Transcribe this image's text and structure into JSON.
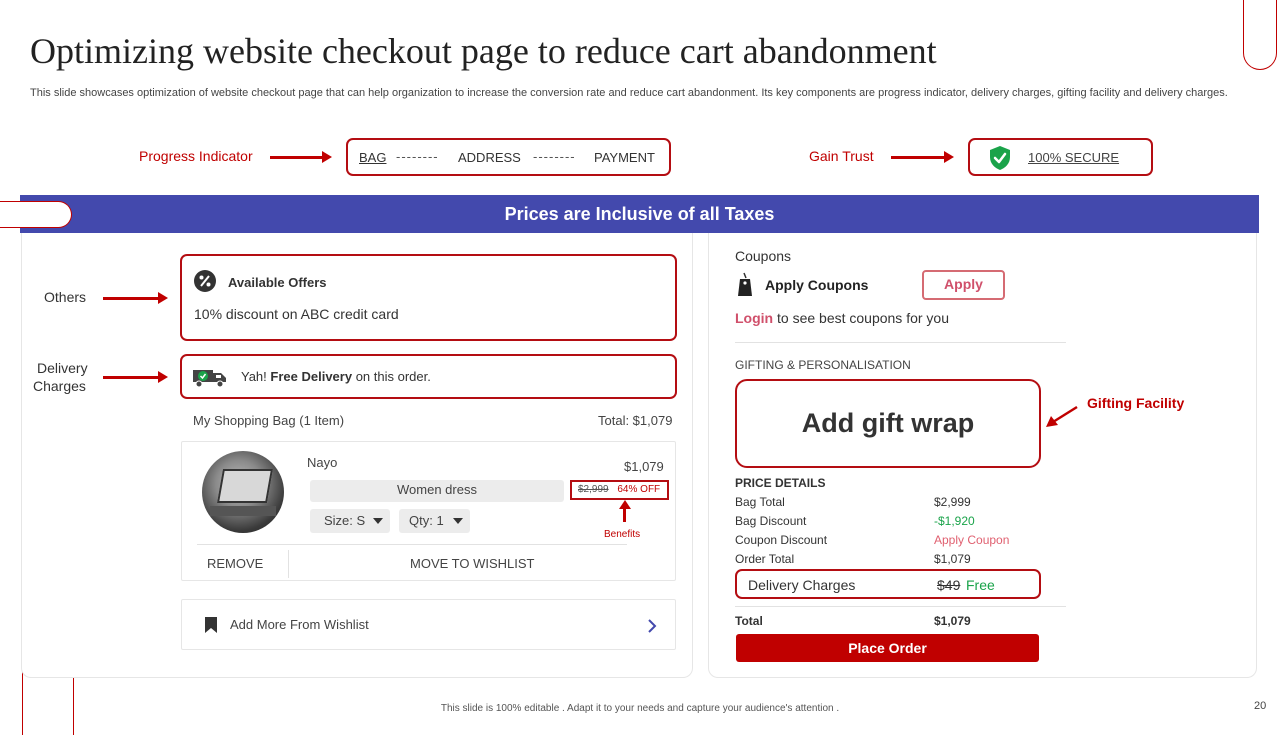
{
  "title": "Optimizing website checkout page to reduce cart abandonment",
  "subtitle": "This slide showcases optimization of website checkout page that can help organization to increase the conversion rate and reduce cart abandonment. Its key components are progress indicator, delivery charges, gifting facility and delivery charges.",
  "labels": {
    "progress_indicator": "Progress Indicator",
    "gain_trust": "Gain Trust",
    "others": "Others",
    "delivery_charges_1": "Delivery",
    "delivery_charges_2": "Charges",
    "gifting_facility": "Gifting Facility",
    "benefits": "Benefits"
  },
  "progress": {
    "step1": "BAG",
    "sep": "--------",
    "step2": "ADDRESS",
    "step3": "PAYMENT"
  },
  "secure": {
    "label": "100% SECURE"
  },
  "banner": "Prices are Inclusive of all Taxes",
  "offers": {
    "heading": "Available Offers",
    "text": "10% discount on ABC credit card"
  },
  "delivery": {
    "prefix": "Yah!",
    "bold": "Free Delivery",
    "suffix": "on this order."
  },
  "bag": {
    "heading": "My Shopping Bag (1 Item)",
    "total": "Total:  $1,079",
    "item": {
      "brand": "Nayo",
      "price": "$1,079",
      "name": "Women dress",
      "old_price": "$2,999",
      "discount": "64% OFF",
      "size": "Size: S",
      "qty": "Qty: 1"
    },
    "remove": "REMOVE",
    "wishlist": "MOVE TO WISHLIST",
    "add_more": "Add More From Wishlist"
  },
  "coupons": {
    "heading": "Coupons",
    "apply_label": "Apply  Coupons",
    "apply_btn": "Apply",
    "login": "Login",
    "login_suffix": "to see best coupons for you"
  },
  "gifting": {
    "heading": "GIFTING  & PERSONALISATION",
    "gift_wrap": "Add gift wrap"
  },
  "price_details": {
    "heading": "PRICE  DETAILS",
    "rows": [
      {
        "label": "Bag Total",
        "value": "$2,999"
      },
      {
        "label": "Bag Discount",
        "value": "-$1,920"
      },
      {
        "label": "Coupon Discount",
        "value": "Apply Coupon"
      },
      {
        "label": "Order Total",
        "value": "$1,079"
      }
    ],
    "delivery_label": "Delivery Charges",
    "delivery_old": "$49",
    "delivery_free": "Free",
    "total_label": "Total",
    "total_value": "$1,079"
  },
  "place_order": "Place Order",
  "footer": "This slide is 100% editable . Adapt it to your needs and capture your audience's attention .",
  "page_number": "20",
  "colors": {
    "accent": "#c00000",
    "banner": "#4349ad",
    "green": "#1aa34a",
    "pink": "#e06070"
  }
}
